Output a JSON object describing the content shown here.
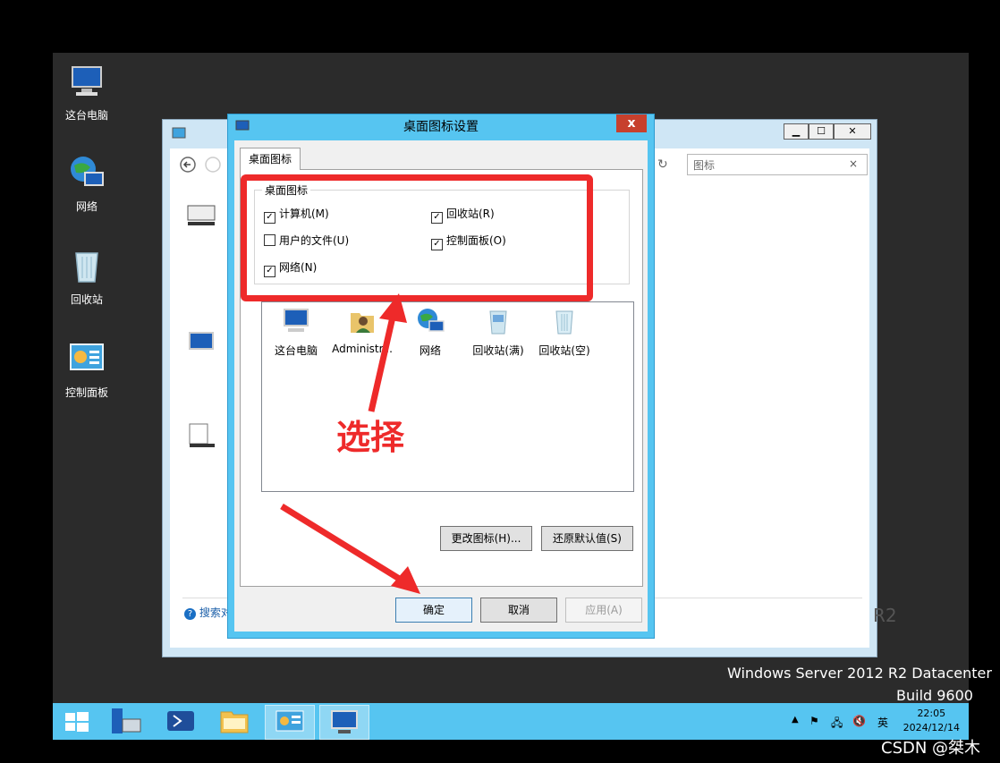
{
  "desktop": {
    "icons": [
      {
        "label": "这台电脑",
        "icon": "computer-icon"
      },
      {
        "label": "网络",
        "icon": "network-icon"
      },
      {
        "label": "回收站",
        "icon": "recycle-bin-icon"
      },
      {
        "label": "控制面板",
        "icon": "control-panel-icon"
      }
    ],
    "watermark_line1": "Windows Server 2012 R2 Datacenter",
    "watermark_line2": "Build 9600"
  },
  "background_window": {
    "search_placeholder": "图标",
    "search_clear": "×",
    "min_label": "▁",
    "max_label": "☐",
    "close_label": "✕",
    "help_link": "搜索对",
    "r2_fragment": "R2"
  },
  "dialog": {
    "title": "桌面图标设置",
    "close_label": "x",
    "tab_label": "桌面图标",
    "group_label": "桌面图标",
    "checkboxes": [
      {
        "label": "计算机(M)",
        "checked": true
      },
      {
        "label": "回收站(R)",
        "checked": true
      },
      {
        "label": "用户的文件(U)",
        "checked": false
      },
      {
        "label": "控制面板(O)",
        "checked": true
      },
      {
        "label": "网络(N)",
        "checked": true
      }
    ],
    "icon_items": [
      {
        "label": "这台电脑",
        "icon": "computer-icon"
      },
      {
        "label": "Administr...",
        "icon": "user-folder-icon"
      },
      {
        "label": "网络",
        "icon": "network-icon"
      },
      {
        "label": "回收站(满)",
        "icon": "recycle-bin-full-icon"
      },
      {
        "label": "回收站(空)",
        "icon": "recycle-bin-empty-icon"
      }
    ],
    "change_icon_button": "更改图标(H)...",
    "restore_default_button": "还原默认值(S)",
    "ok_button": "确定",
    "cancel_button": "取消",
    "apply_button": "应用(A)"
  },
  "annotation": {
    "text": "选择",
    "color": "#ee2a2a"
  },
  "taskbar": {
    "time": "22:05",
    "date": "2024/12/14",
    "ime": "英"
  },
  "watermark": "CSDN @桀木"
}
